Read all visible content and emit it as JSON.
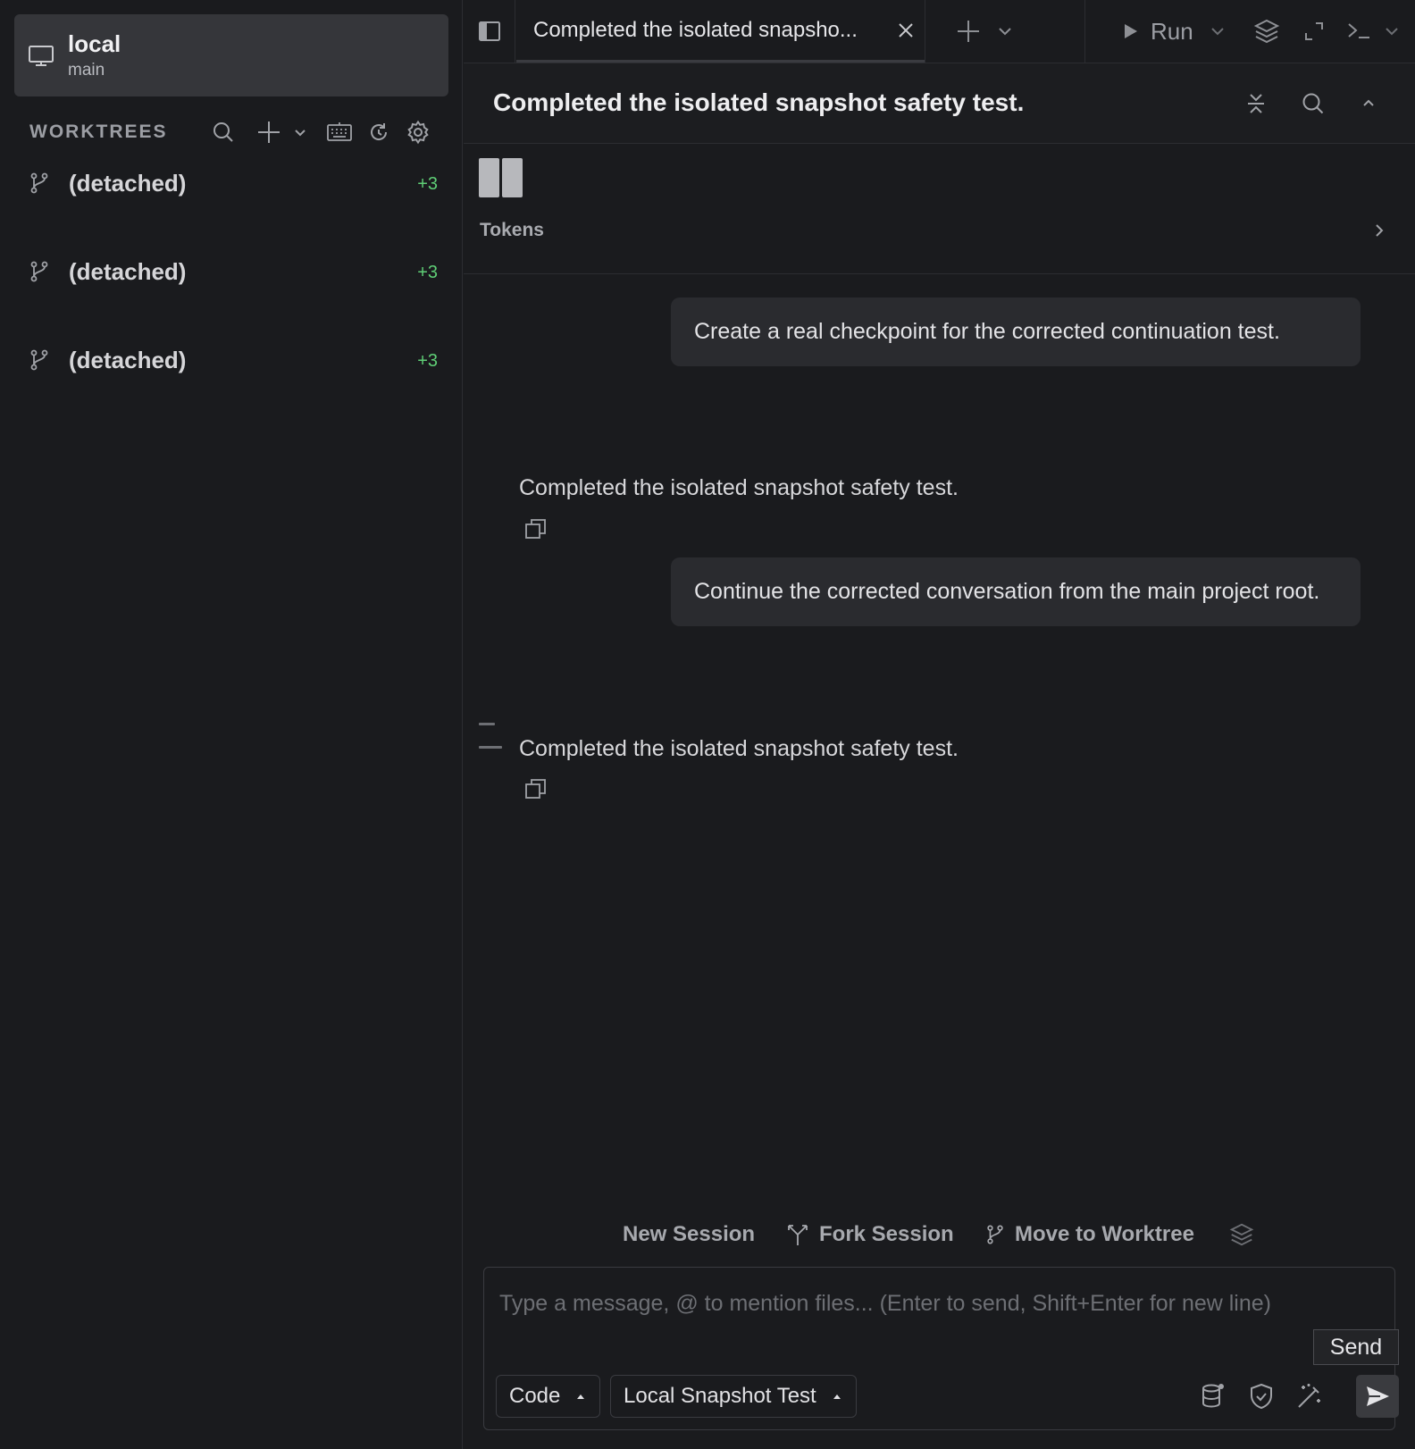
{
  "sidebar": {
    "environment": {
      "name": "local",
      "branch": "main",
      "icon": "monitor-icon"
    },
    "worktrees_title": "WORKTREES",
    "tools": [
      "search-icon",
      "plus-icon",
      "chevron-down-icon",
      "keyboard-icon",
      "refresh-icon",
      "gear-icon"
    ],
    "worktrees": [
      {
        "name": "(detached)",
        "count": "+3",
        "icon": "git-branch-icon"
      },
      {
        "name": "(detached)",
        "count": "+3",
        "icon": "git-branch-icon"
      },
      {
        "name": "(detached)",
        "count": "+3",
        "icon": "git-branch-icon"
      }
    ]
  },
  "tabbar": {
    "tab_label": "Completed the isolated snapsho...",
    "run_label": "Run"
  },
  "session": {
    "title": "Completed the isolated snapshot safety test.",
    "tokens_label": "Tokens"
  },
  "conversation": {
    "messages": [
      {
        "role": "user",
        "text": "Create a real checkpoint for the corrected continuation test."
      },
      {
        "role": "assistant",
        "text": "Completed the isolated snapshot safety test."
      },
      {
        "role": "user",
        "text": "Continue the corrected conversation from the main project root."
      },
      {
        "role": "assistant",
        "text": "Completed the isolated snapshot safety test."
      }
    ]
  },
  "actions": {
    "new_session": "New Session",
    "fork_session": "Fork Session",
    "move_to_worktree": "Move to Worktree"
  },
  "composer": {
    "placeholder": "Type a message, @ to mention files... (Enter to send, Shift+Enter for new line)",
    "value": "",
    "mode": "Code",
    "profile": "Local Snapshot Test",
    "send_tooltip": "Send"
  },
  "colors": {
    "background": "#1a1b1e",
    "panel": "#35363a",
    "bubble": "#2a2b2f",
    "accent_green": "#5fcf76",
    "muted": "#9c9ea4"
  }
}
